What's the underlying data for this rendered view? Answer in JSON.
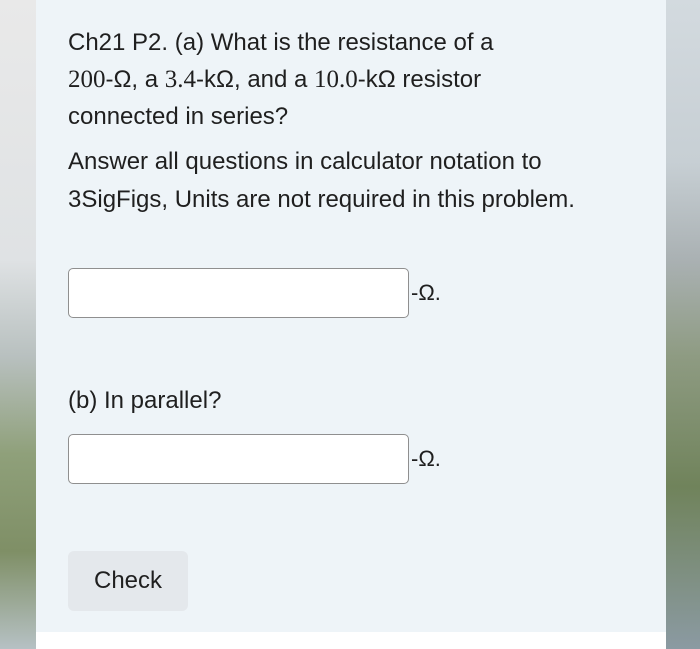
{
  "question": {
    "prefix": "Ch21 P2. (a) What is the resistance of a",
    "r1_value": "200",
    "r1_unit": "-Ω, a ",
    "r2_value": "3.4",
    "r2_unit": "-kΩ, and a ",
    "r3_value": "10.0",
    "r3_unit": "-kΩ resistor",
    "suffix": "connected in series?"
  },
  "instructions": "Answer all questions in calculator notation to 3SigFigs, Units are not required in this problem.",
  "part_a": {
    "input_value": "",
    "unit": "-Ω."
  },
  "part_b": {
    "label": "(b) In parallel?",
    "input_value": "",
    "unit": "-Ω."
  },
  "check_button": {
    "label": "Check"
  }
}
